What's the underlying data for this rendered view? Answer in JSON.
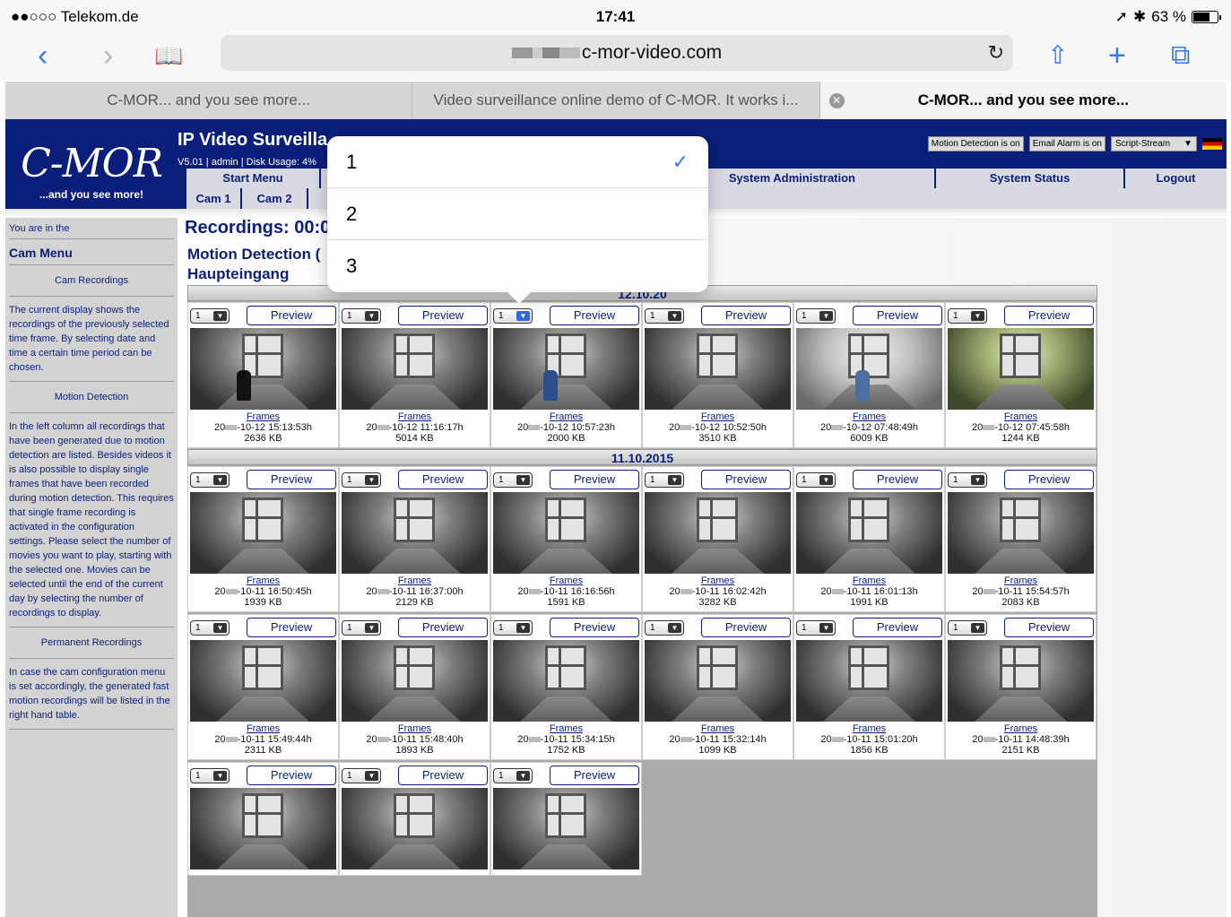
{
  "status_bar": {
    "carrier": "●●○○○ Telekom.de",
    "wifi": "wifi-icon",
    "time": "17:41",
    "location": "➚",
    "bluetooth": "✱",
    "battery": "63 %"
  },
  "toolbar": {
    "back": "‹",
    "forward": "›",
    "bookmarks": "📖",
    "url_domain": "c-mor-video.com",
    "reload": "↻",
    "share": "⇧",
    "new_tab": "+",
    "tabs": "⧉"
  },
  "tabs": [
    {
      "label": "C-MOR... and you see more..."
    },
    {
      "label": "Video surveillance online demo of C-MOR. It works i..."
    },
    {
      "label": "C-MOR... and you see more..."
    }
  ],
  "site": {
    "logo": "C-MOR",
    "tagline": "...and you see more!",
    "title": "IP Video Surveilla",
    "subtitle": "V5.01 | admin | Disk Usage: 4%",
    "badges": {
      "motion": "Motion Detection is on",
      "email": "Email Alarm is on",
      "stream": "Script-Stream",
      "stream_arrow": "▼"
    },
    "menu": [
      "Start Menu",
      "System Administration",
      "System Status",
      "Logout"
    ],
    "cams": [
      "Cam 1",
      "Cam 2"
    ]
  },
  "sidebar": {
    "you_are": "You are in the",
    "cam_menu": "Cam Menu",
    "cam_recordings": "Cam Recordings",
    "text1": "The current display shows the recordings of the previously selected time frame. By selecting date and time a certain time period can be chosen.",
    "motion_detection": "Motion Detection",
    "text2": "In the left column all recordings that have been generated due to motion detection are listed. Besides videos it is also possible to display single frames that have been recorded during motion detection. This requires that single frame recording is activated in the configuration settings. Please select the number of movies you want to play, starting with the selected one. Movies can be selected until the end of the current day by selecting the number of recordings to display.",
    "permanent": "Permanent Recordings",
    "text3": "In case the cam configuration menu is set accordingly, the generated fast motion recordings will be listed in the right hand table."
  },
  "main": {
    "title": "Recordings: 00:0",
    "subtitle1": "Motion Detection (",
    "subtitle2": "Haupteingang",
    "date1": "12.10.20",
    "date2": "11.10.2015",
    "select_value": "1",
    "preview_label": "Preview",
    "frames_label": "Frames",
    "rows": [
      [
        {
          "ts": "-10-12 15:13:53h",
          "size": "2636 KB",
          "tone": "dark",
          "person": "#111"
        },
        {
          "ts": "-10-12 11:16:17h",
          "size": "5014 KB",
          "tone": "dark",
          "person": ""
        },
        {
          "ts": "-10-12 10:57:23h",
          "size": "2000 KB",
          "tone": "dark",
          "person": "#2a4f8a"
        },
        {
          "ts": "-10-12 10:52:50h",
          "size": "3510 KB",
          "tone": "dark",
          "person": ""
        },
        {
          "ts": "-10-12 07:48:49h",
          "size": "6009 KB",
          "tone": "light",
          "person": "#4a6fa0"
        },
        {
          "ts": "-10-12 07:45:58h",
          "size": "1244 KB",
          "tone": "green",
          "person": ""
        }
      ],
      [
        {
          "ts": "-10-11 16:50:45h",
          "size": "1939 KB",
          "tone": "dark",
          "person": ""
        },
        {
          "ts": "-10-11 16:37:00h",
          "size": "2129 KB",
          "tone": "dark",
          "person": ""
        },
        {
          "ts": "-10-11 16:16:56h",
          "size": "1591 KB",
          "tone": "dark",
          "person": ""
        },
        {
          "ts": "-10-11 16:02:42h",
          "size": "3282 KB",
          "tone": "dark",
          "person": ""
        },
        {
          "ts": "-10-11 16:01:13h",
          "size": "1991 KB",
          "tone": "dark",
          "person": ""
        },
        {
          "ts": "-10-11 15:54:57h",
          "size": "2083 KB",
          "tone": "dark",
          "person": ""
        }
      ],
      [
        {
          "ts": "-10-11 15:49:44h",
          "size": "2311 KB",
          "tone": "dark",
          "person": ""
        },
        {
          "ts": "-10-11 15:48:40h",
          "size": "1893 KB",
          "tone": "dark",
          "person": ""
        },
        {
          "ts": "-10-11 15:34:15h",
          "size": "1752 KB",
          "tone": "dark",
          "person": ""
        },
        {
          "ts": "-10-11 15:32:14h",
          "size": "1099 KB",
          "tone": "dark",
          "person": ""
        },
        {
          "ts": "-10-11 15:01:20h",
          "size": "1856 KB",
          "tone": "dark",
          "person": ""
        },
        {
          "ts": "-10-11 14:48:39h",
          "size": "2151 KB",
          "tone": "dark",
          "person": ""
        }
      ],
      [
        {
          "ts": "",
          "size": "",
          "tone": "dark",
          "person": ""
        },
        {
          "ts": "",
          "size": "",
          "tone": "dark",
          "person": ""
        },
        {
          "ts": "",
          "size": "",
          "tone": "dark",
          "person": ""
        }
      ]
    ]
  },
  "popover": {
    "options": [
      "1",
      "2",
      "3"
    ],
    "selected": "1",
    "check": "✓"
  }
}
